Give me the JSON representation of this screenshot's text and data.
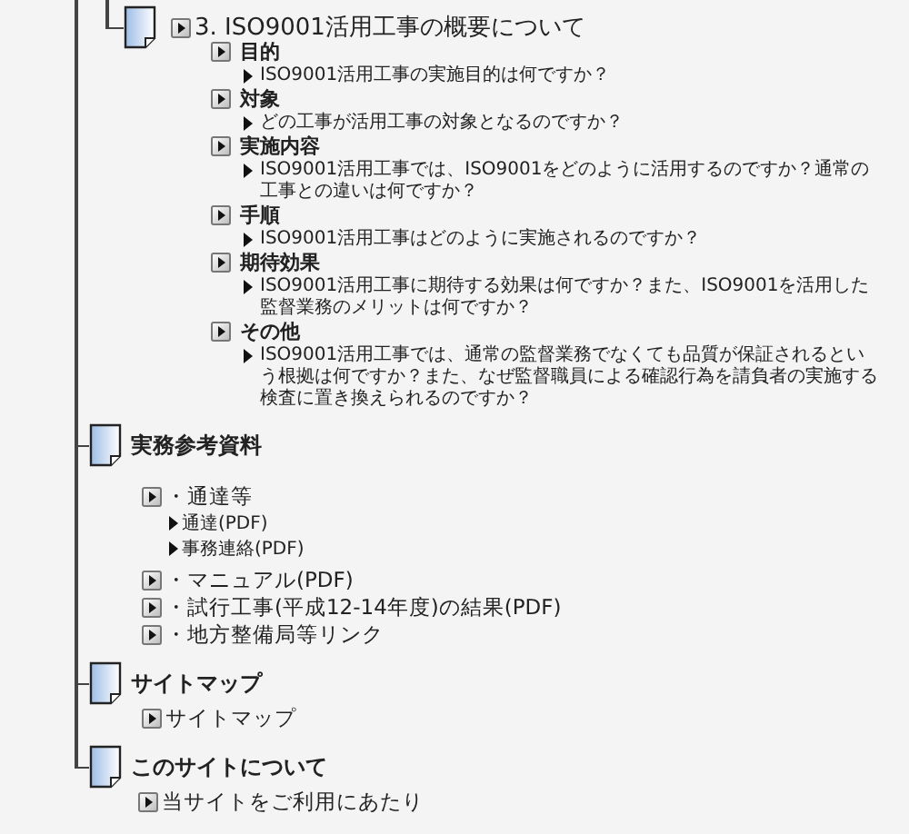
{
  "tree": [
    {
      "children": [
        {
          "label": "3. ISO9001活用工事の概要について",
          "children": [
            {
              "label": "目的",
              "children": [
                {
                  "label": "ISO9001活用工事の実施目的は何ですか？"
                }
              ]
            },
            {
              "label": "対象",
              "children": [
                {
                  "label": "どの工事が活用工事の対象となるのですか？"
                }
              ]
            },
            {
              "label": "実施内容",
              "children": [
                {
                  "label": "ISO9001活用工事では、ISO9001をどのように活用するのですか？通常の工事との違いは何ですか？"
                }
              ]
            },
            {
              "label": "手順",
              "children": [
                {
                  "label": "ISO9001活用工事はどのように実施されるのですか？"
                }
              ]
            },
            {
              "label": "期待効果",
              "children": [
                {
                  "label": "ISO9001活用工事に期待する効果は何ですか？また、ISO9001を活用した監督業務のメリットは何ですか？"
                }
              ]
            },
            {
              "label": "その他",
              "children": [
                {
                  "label": "ISO9001活用工事では、通常の監督業務でなくても品質が保証されるという根拠は何ですか？また、なぜ監督職員による確認行為を請負者の実施する検査に置き換えられるのですか？"
                }
              ]
            }
          ]
        }
      ]
    },
    {
      "label": "実務参考資料",
      "children": [
        {
          "label": "・通達等",
          "children": [
            {
              "label": "通達(PDF)"
            },
            {
              "label": "事務連絡(PDF)"
            }
          ]
        },
        {
          "label": "・マニュアル(PDF)"
        },
        {
          "label": "・試行工事(平成12-14年度)の結果(PDF)"
        },
        {
          "label": "・地方整備局等リンク"
        }
      ]
    },
    {
      "label": "サイトマップ",
      "children": [
        {
          "label": "サイトマップ"
        }
      ]
    },
    {
      "label": "このサイトについて",
      "children": [
        {
          "label": "当サイトをご利用にあたり"
        }
      ]
    }
  ]
}
